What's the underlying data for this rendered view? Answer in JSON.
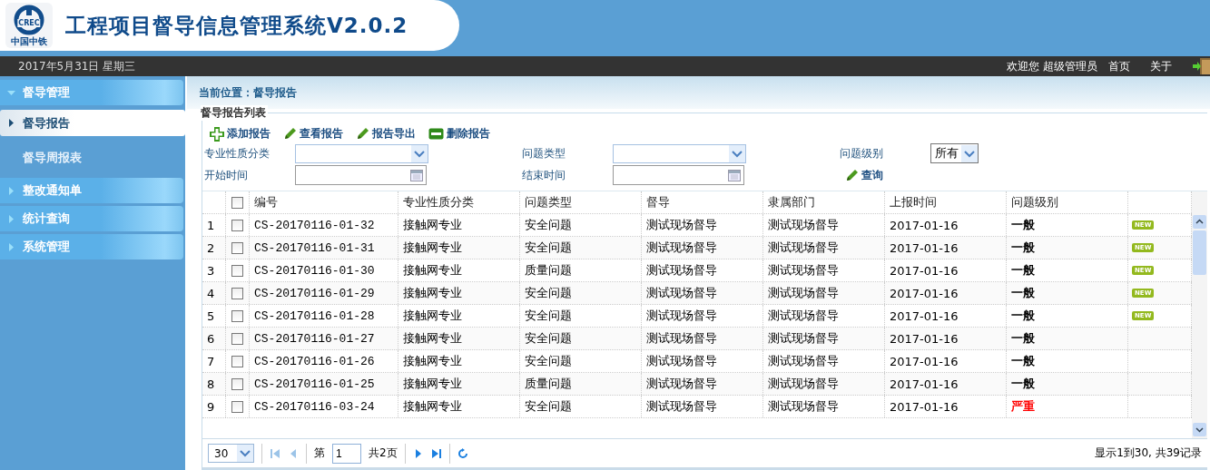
{
  "header": {
    "logo_text": "中国中铁",
    "logo_mark": "CREC",
    "title": "工程项目督导信息管理系统V2.0.2"
  },
  "topbar": {
    "date": "2017年5月31日 星期三",
    "welcome": "欢迎您 超级管理员",
    "links": [
      "首页",
      "关于"
    ]
  },
  "sidebar": [
    {
      "label": "督导管理",
      "expanded": true,
      "children": [
        {
          "label": "督导报告",
          "selected": true
        },
        {
          "label": "督导周报表",
          "selected": false
        }
      ]
    },
    {
      "label": "整改通知单",
      "expanded": false
    },
    {
      "label": "统计查询",
      "expanded": false
    },
    {
      "label": "系统管理",
      "expanded": false
    }
  ],
  "breadcrumb": "当前位置：督导报告",
  "panel_title": "督导报告列表",
  "toolbar": [
    {
      "label": "添加报告",
      "kind": "add"
    },
    {
      "label": "查看报告",
      "kind": "edit"
    },
    {
      "label": "报告导出",
      "kind": "edit"
    },
    {
      "label": "删除报告",
      "kind": "remove"
    }
  ],
  "filters": {
    "category_label": "专业性质分类",
    "type_label": "问题类型",
    "level_label": "问题级别",
    "level_value": "所有",
    "start_label": "开始时间",
    "end_label": "结束时间",
    "query": "查询"
  },
  "table": {
    "select_all_checked": false,
    "columns": [
      "编号",
      "专业性质分类",
      "问题类型",
      "督导",
      "隶属部门",
      "上报时间",
      "问题级别"
    ],
    "rows": [
      {
        "n": "1",
        "checked": false,
        "cells": [
          "CS-20170116-01-32",
          "接触网专业",
          "安全问题",
          "测试现场督导",
          "测试现场督导",
          "2017-01-16",
          "一般"
        ],
        "badge": "NEW"
      },
      {
        "n": "2",
        "checked": false,
        "cells": [
          "CS-20170116-01-31",
          "接触网专业",
          "安全问题",
          "测试现场督导",
          "测试现场督导",
          "2017-01-16",
          "一般"
        ],
        "badge": "NEW"
      },
      {
        "n": "3",
        "checked": false,
        "cells": [
          "CS-20170116-01-30",
          "接触网专业",
          "质量问题",
          "测试现场督导",
          "测试现场督导",
          "2017-01-16",
          "一般"
        ],
        "badge": "NEW"
      },
      {
        "n": "4",
        "checked": false,
        "cells": [
          "CS-20170116-01-29",
          "接触网专业",
          "安全问题",
          "测试现场督导",
          "测试现场督导",
          "2017-01-16",
          "一般"
        ],
        "badge": "NEW"
      },
      {
        "n": "5",
        "checked": false,
        "cells": [
          "CS-20170116-01-28",
          "接触网专业",
          "安全问题",
          "测试现场督导",
          "测试现场督导",
          "2017-01-16",
          "一般"
        ],
        "badge": "NEW"
      },
      {
        "n": "6",
        "checked": false,
        "cells": [
          "CS-20170116-01-27",
          "接触网专业",
          "安全问题",
          "测试现场督导",
          "测试现场督导",
          "2017-01-16",
          "一般"
        ]
      },
      {
        "n": "7",
        "checked": false,
        "cells": [
          "CS-20170116-01-26",
          "接触网专业",
          "安全问题",
          "测试现场督导",
          "测试现场督导",
          "2017-01-16",
          "一般"
        ]
      },
      {
        "n": "8",
        "checked": false,
        "cells": [
          "CS-20170116-01-25",
          "接触网专业",
          "质量问题",
          "测试现场督导",
          "测试现场督导",
          "2017-01-16",
          "一般"
        ]
      },
      {
        "n": "9",
        "checked": false,
        "cells": [
          "CS-20170116-03-24",
          "接触网专业",
          "安全问题",
          "测试现场督导",
          "测试现场督导",
          "2017-01-16",
          "严重"
        ],
        "color": "#ff0000"
      }
    ]
  },
  "pager": {
    "page_size": "30",
    "page_prefix": "第",
    "page": "1",
    "page_suffix": "共2页",
    "summary": "显示1到30, 共39记录"
  }
}
